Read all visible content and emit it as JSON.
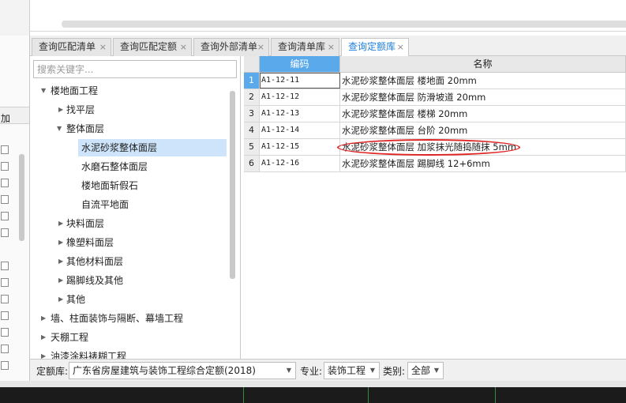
{
  "tabs": [
    {
      "label": "查询匹配清单",
      "close": "×"
    },
    {
      "label": "查询匹配定额",
      "close": "×"
    },
    {
      "label": "查询外部清单",
      "close": "×"
    },
    {
      "label": "查询清单库",
      "close": "×"
    },
    {
      "label": "查询定额库",
      "close": "×",
      "active": true
    }
  ],
  "left_panel": {
    "column_header": "加"
  },
  "tree": {
    "search_placeholder": "搜索关键字...",
    "items": [
      {
        "label": "楼地面工程",
        "arrow": "▼"
      },
      {
        "label": "找平层",
        "arrow": "▶"
      },
      {
        "label": "整体面层",
        "arrow": "▼"
      },
      {
        "label": "水泥砂浆整体面层",
        "selected": true
      },
      {
        "label": "水磨石整体面层"
      },
      {
        "label": "楼地面斩假石"
      },
      {
        "label": "自流平地面"
      },
      {
        "label": "块料面层",
        "arrow": "▶"
      },
      {
        "label": "橡塑料面层",
        "arrow": "▶"
      },
      {
        "label": "其他材料面层",
        "arrow": "▶"
      },
      {
        "label": "踢脚线及其他",
        "arrow": "▶"
      },
      {
        "label": "其他",
        "arrow": "▶"
      },
      {
        "label": "墙、柱面装饰与隔断、幕墙工程",
        "arrow": "▶"
      },
      {
        "label": "天棚工程",
        "arrow": "▶"
      },
      {
        "label": "油漆涂料裱糊工程",
        "arrow": "▶"
      }
    ]
  },
  "grid": {
    "headers": {
      "code": "编码",
      "name": "名称"
    },
    "rows": [
      {
        "no": "1",
        "code": "A1-12-11",
        "name": "水泥砂浆整体面层 楼地面 20mm"
      },
      {
        "no": "2",
        "code": "A1-12-12",
        "name": "水泥砂浆整体面层 防滑坡道 20mm"
      },
      {
        "no": "3",
        "code": "A1-12-13",
        "name": "水泥砂浆整体面层 楼梯 20mm"
      },
      {
        "no": "4",
        "code": "A1-12-14",
        "name": "水泥砂浆整体面层 台阶 20mm"
      },
      {
        "no": "5",
        "code": "A1-12-15",
        "name": "水泥砂浆整体面层 加浆抹光随捣随抹 5mm"
      },
      {
        "no": "6",
        "code": "A1-12-16",
        "name": "水泥砂浆整体面层 踢脚线 12+6mm"
      }
    ],
    "selected_row": 0,
    "highlight_color": "#5aa9ea",
    "annotation_color": "#e02424"
  },
  "bottom_bar": {
    "quota_label": "定额库:",
    "quota_value": "广东省房屋建筑与装饰工程综合定额(2018)",
    "major_label": "专业:",
    "major_value": "装饰工程",
    "category_label": "类别:",
    "category_value": "全部",
    "dropdown_icon": "▼"
  }
}
